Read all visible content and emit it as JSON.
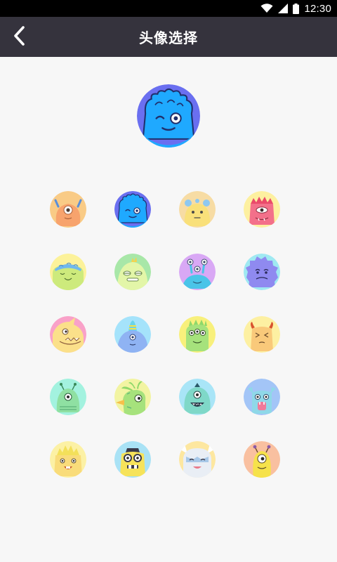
{
  "status_bar": {
    "time": "12:30",
    "icons": [
      "wifi-icon",
      "signal-icon",
      "battery-icon"
    ],
    "background": "#000000"
  },
  "app_bar": {
    "title": "头像选择",
    "back_icon": "chevron-left-icon",
    "background": "#35333d"
  },
  "selected_avatar": {
    "name": "blue-shaggy-monster",
    "bg": "#6a6ff0",
    "face": "#1fa9ff"
  },
  "avatars": [
    {
      "name": "orange-cyclops-monster",
      "bg": "#f9cb86"
    },
    {
      "name": "blue-shaggy-monster",
      "bg": "#6a6ff0"
    },
    {
      "name": "yellow-bear-monster",
      "bg": "#f7dca4"
    },
    {
      "name": "pink-spiky-monster",
      "bg": "#fdf0a0"
    },
    {
      "name": "green-cap-monster",
      "bg": "#fcf29a"
    },
    {
      "name": "green-sleepy-monster",
      "bg": "#a8e7a8"
    },
    {
      "name": "purple-antenna-monster",
      "bg": "#d9a8f5"
    },
    {
      "name": "purple-fuzzy-monster",
      "bg": "#9fe9f2"
    },
    {
      "name": "yellow-fin-monster",
      "bg": "#f9a1c8"
    },
    {
      "name": "blue-cone-monster",
      "bg": "#a5e3fb"
    },
    {
      "name": "green-three-eyed-monster",
      "bg": "#f8f07c"
    },
    {
      "name": "yellow-horned-monster",
      "bg": "#fdf0a2"
    },
    {
      "name": "green-bug-monster",
      "bg": "#a3f2df"
    },
    {
      "name": "green-parrot-monster",
      "bg": "#f2f4a2"
    },
    {
      "name": "teal-cyclops-monster",
      "bg": "#a9e5f7"
    },
    {
      "name": "blue-cat-monster",
      "bg": "#a3c5f7"
    },
    {
      "name": "yellow-spiky-hair-monster",
      "bg": "#fcf1a5"
    },
    {
      "name": "yellow-goggles-monster",
      "bg": "#a9e2f5"
    },
    {
      "name": "white-mask-monster",
      "bg": "#fde7a0"
    },
    {
      "name": "yellow-antenna-monster",
      "bg": "#f9c0a0"
    }
  ]
}
